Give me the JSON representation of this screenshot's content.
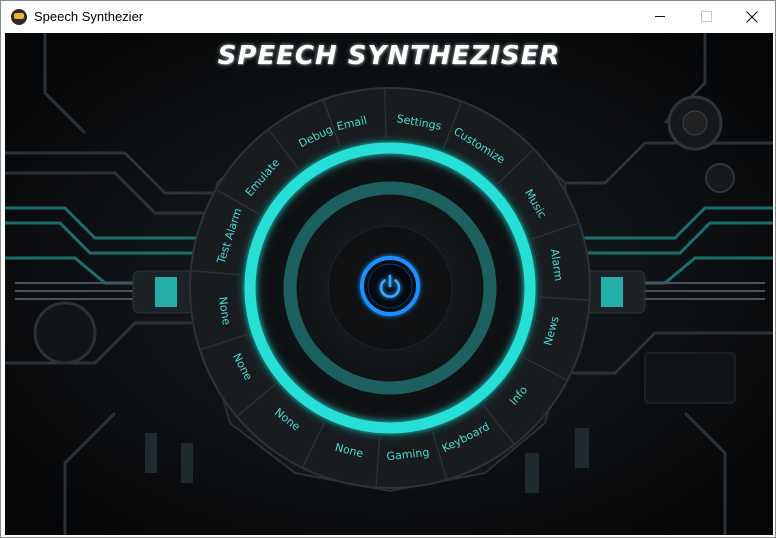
{
  "window": {
    "title": "Speech Synthezier"
  },
  "app": {
    "title": "SPEECH SYNTHEZISER"
  },
  "menu": {
    "items": [
      {
        "label": "Email",
        "key": "email"
      },
      {
        "label": "Settings",
        "key": "settings"
      },
      {
        "label": "Customize",
        "key": "customize"
      },
      {
        "label": "Music",
        "key": "music"
      },
      {
        "label": "Alarm",
        "key": "alarm"
      },
      {
        "label": "News",
        "key": "news"
      },
      {
        "label": "Info",
        "key": "info"
      },
      {
        "label": "Keyboard",
        "key": "keyboard"
      },
      {
        "label": "Gaming",
        "key": "gaming"
      },
      {
        "label": "None",
        "key": "none-1"
      },
      {
        "label": "None",
        "key": "none-2"
      },
      {
        "label": "None",
        "key": "none-3"
      },
      {
        "label": "None",
        "key": "none-4"
      },
      {
        "label": "Test Alarm",
        "key": "test-alarm"
      },
      {
        "label": "Emulate",
        "key": "emulate"
      },
      {
        "label": "Debug",
        "key": "debug"
      }
    ]
  },
  "colors": {
    "accent": "#27e0d8",
    "power": "#1e90ff",
    "background": "#0a0d10"
  },
  "icons": {
    "power": "power-icon",
    "app": "app-icon"
  }
}
